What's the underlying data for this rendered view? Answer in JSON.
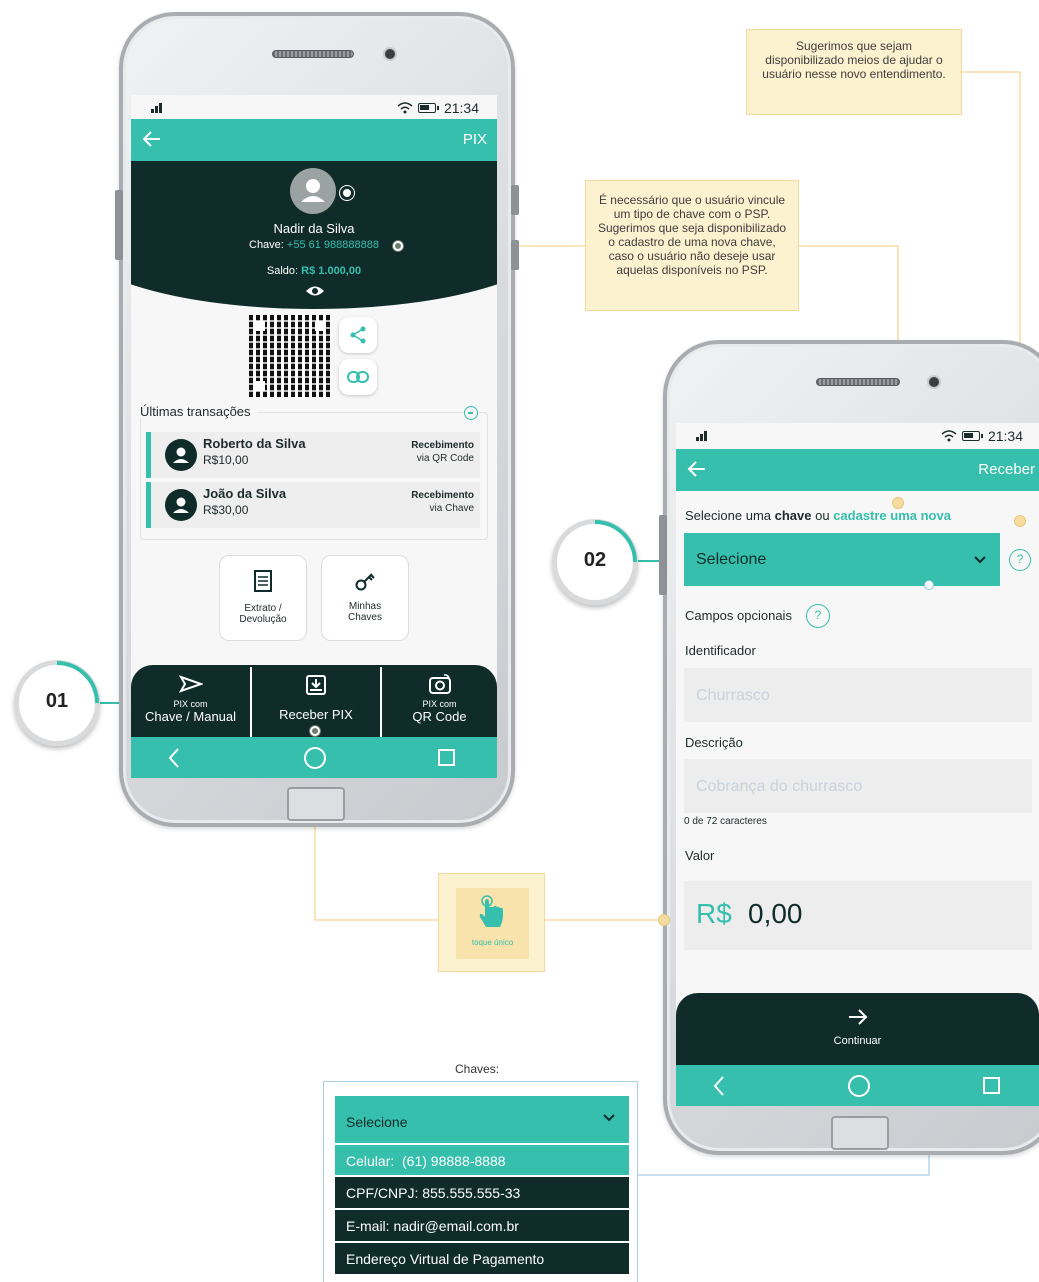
{
  "phone1": {
    "status_time": "21:34",
    "topbar_title": "PIX",
    "user_name": "Nadir da Silva",
    "key_label": "Chave:",
    "key_value": "+55 61 988888888",
    "balance_label": "Saldo:",
    "balance_value": "R$ 1.000,00",
    "transactions_title": "Últimas transações",
    "transactions": [
      {
        "name": "Roberto da Silva",
        "amount": "R$10,00",
        "type": "Recebimento",
        "via": "via QR Code"
      },
      {
        "name": "João da Silva",
        "amount": "R$30,00",
        "type": "Recebimento",
        "via": "via Chave"
      }
    ],
    "actions": [
      {
        "line1": "Extrato /",
        "line2": "Devolução"
      },
      {
        "line1": "Minhas",
        "line2": "Chaves"
      }
    ],
    "bottom_bar": [
      {
        "small": "PIX com",
        "label": "Chave / Manual"
      },
      {
        "small": "",
        "label": "Receber PIX"
      },
      {
        "small": "PIX com",
        "label": "QR Code"
      }
    ]
  },
  "phone2": {
    "status_time": "21:34",
    "topbar_title": "Receber",
    "select_prefix": "Selecione uma ",
    "select_bold": "chave",
    "select_mid": " ou ",
    "select_link": "cadastre uma nova",
    "select_value": "Selecione",
    "optional_label": "Campos opcionais",
    "identifier_label": "Identificador",
    "identifier_placeholder": "Churrasco",
    "description_label": "Descrição",
    "description_placeholder": "Cobrança do churrasco",
    "char_count": "0 de 72 caracteres",
    "value_label": "Valor",
    "currency": "R$",
    "amount": "0,00",
    "continue_label": "Continuar"
  },
  "notes": {
    "top_right": "Sugerimos que sejam disponibilizado meios de ajudar o usuário nesse novo entendimento.",
    "middle": "É necessário que o usuário vincule um tipo de chave com o PSP. Sugerimos que seja disponibilizado o cadastro de uma nova chave, caso o usuário não deseje usar aquelas disponíveis no PSP."
  },
  "steps": {
    "one": "01",
    "two": "02"
  },
  "touch_label": "toque único",
  "keys_panel": {
    "title": "Chaves:",
    "select_value": "Selecione",
    "options": [
      "Celular:  (61) 98888-8888",
      "CPF/CNPJ: 855.555.555-33",
      "E-mail: nadir@email.com.br",
      "Endereço Virtual de Pagamento"
    ]
  },
  "colors": {
    "accent": "#35bfac",
    "dark": "#0f2c2a",
    "note_bg": "#fdf2cf"
  }
}
